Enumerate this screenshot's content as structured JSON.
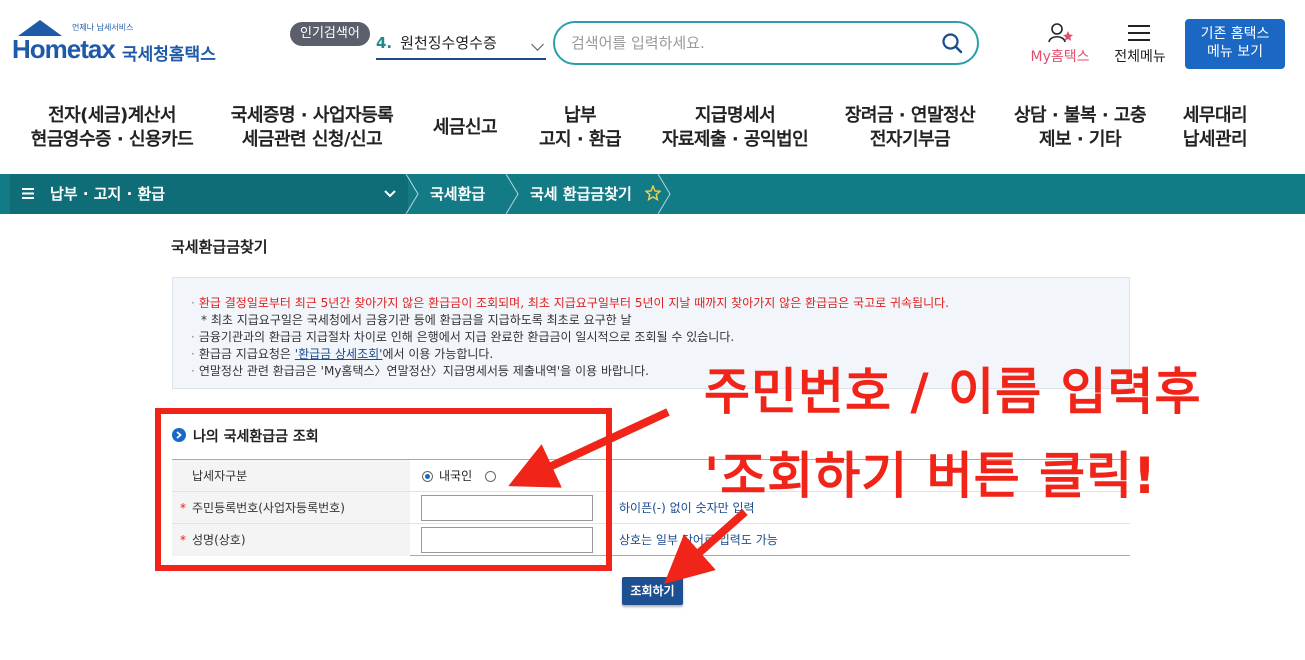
{
  "header": {
    "logo_small": "언제나 납세서비스",
    "logo_main": "Hometax",
    "logo_sub": "국세청홈택스",
    "popular_badge": "인기검색어",
    "popular_rank": "4.",
    "popular_keyword": "원천징수영수증",
    "search_placeholder": "검색어를 입력하세요.",
    "my_hometax": "My홈택스",
    "all_menu": "전체메뉴",
    "old_menu_line1": "기존 홈택스",
    "old_menu_line2": "메뉴 보기"
  },
  "gnb": [
    {
      "line1": "전자(세금)계산서",
      "line2": "현금영수증 · 신용카드"
    },
    {
      "line1": "국세증명 · 사업자등록",
      "line2": "세금관련 신청/신고"
    },
    {
      "line1": "세금신고",
      "line2": ""
    },
    {
      "line1": "납부",
      "line2": "고지 · 환급"
    },
    {
      "line1": "지급명세서",
      "line2": "자료제출 · 공익법인"
    },
    {
      "line1": "장려금 · 연말정산",
      "line2": "전자기부금"
    },
    {
      "line1": "상담 · 불복 · 고충",
      "line2": "제보 · 기타"
    },
    {
      "line1": "세무대리",
      "line2": "납세관리"
    }
  ],
  "breadcrumb": {
    "section": "납부 · 고지 · 환급",
    "level2": "국세환급",
    "level3": "국세 환급금찾기"
  },
  "page": {
    "title": "국세환급금찾기",
    "notices": {
      "n1": "환급 결정일로부터 최근 5년간 찾아가지 않은 환급금이 조회되며, 최초 지급요구일부터 5년이 지날 때까지 찾아가지 않은 환급금은 국고로 귀속됩니다.",
      "n2": "* 최초 지급요구일은 국세청에서 금융기관 등에 환급금을 지급하도록 최초로 요구한 날",
      "n3": "금융기관과의 환급금 지급절차 차이로 인해 은행에서 지급 완료한 환급금이 일시적으로 조회될 수 있습니다.",
      "n4_pre": "환급금 지급요청은 ",
      "n4_link": "'환급금 상세조회'",
      "n4_post": "에서 이용 가능합니다.",
      "n5": "연말정산 관련 환급금은 'My홈택스〉연말정산〉지급명세서등 제출내역'을 이용 바랍니다."
    },
    "section_title": "나의 국세환급금 조회",
    "form": {
      "taxpayer_type_label": "납세자구분",
      "domestic_label": "내국인",
      "id_label": "주민등록번호(사업자등록번호)",
      "id_help": "하이픈(-) 없이 숫자만 입력",
      "name_label": "성명(상호)",
      "name_help": "상호는 일부 단어로 입력도 가능",
      "required_mark": "*"
    },
    "search_button": "조회하기"
  },
  "annotation": {
    "line1": "주민번호 / 이름 입력후",
    "line2": "'조회하기 버튼 클릭!",
    "color": "#f02418"
  }
}
